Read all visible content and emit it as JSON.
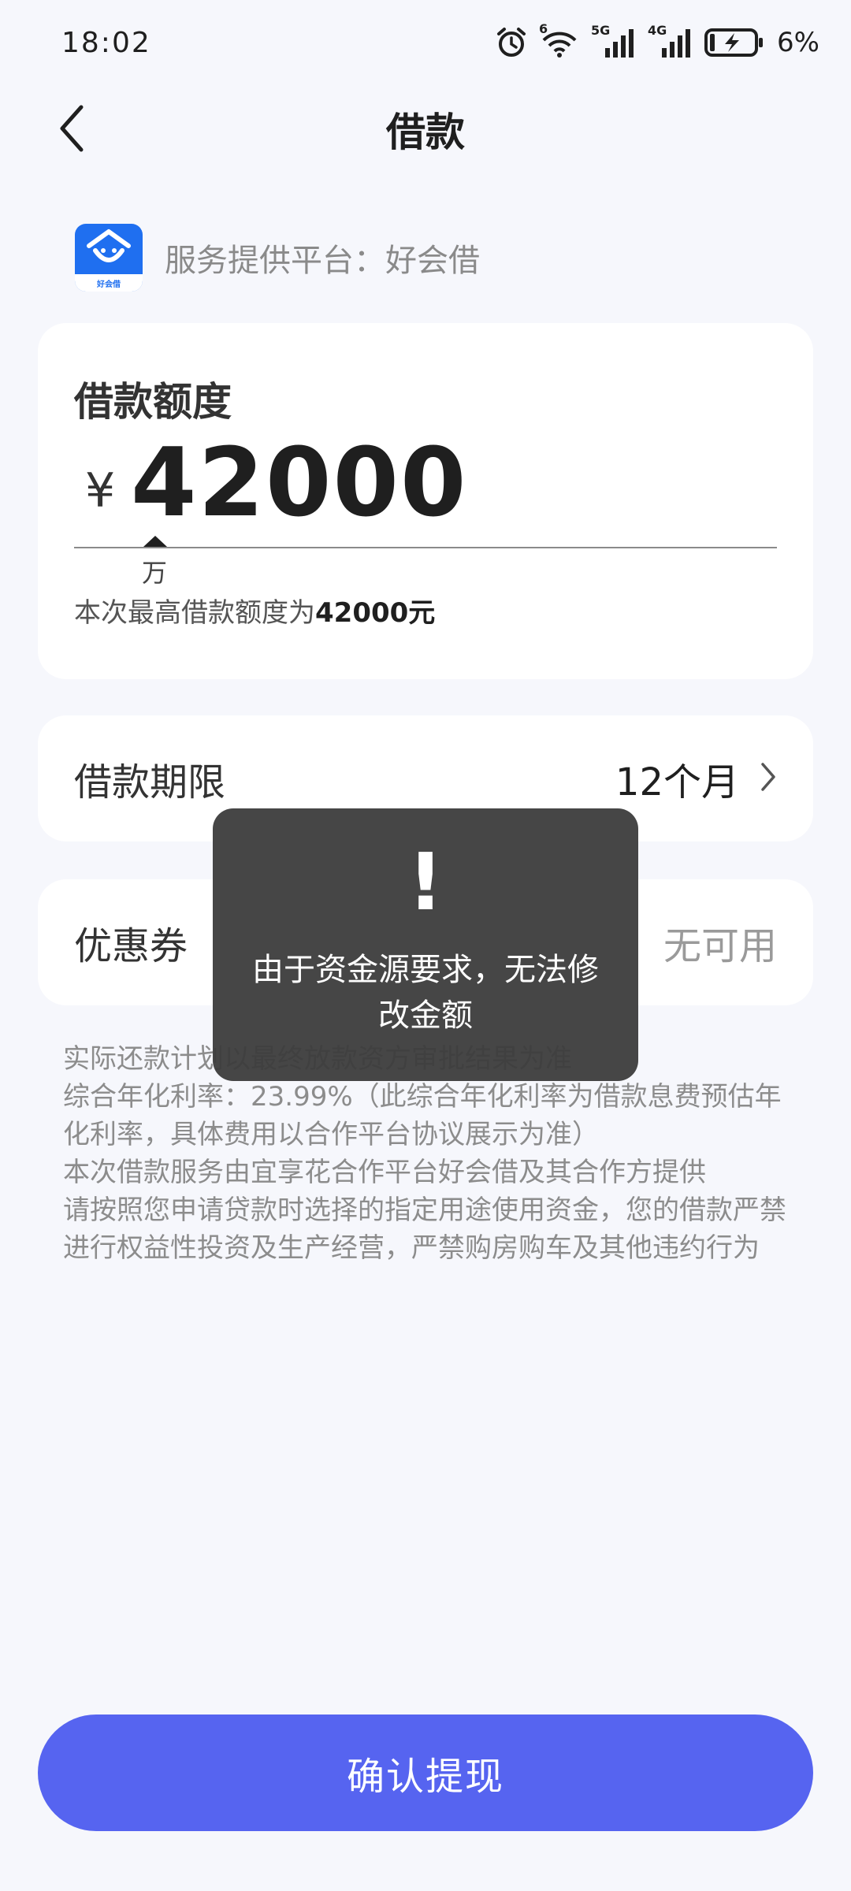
{
  "status_bar": {
    "time": "18:02",
    "battery_percent": "6%",
    "wifi_label": "6",
    "net1": "5G",
    "net2": "4G"
  },
  "header": {
    "title": "借款",
    "back_icon": "chevron-left-icon"
  },
  "provider": {
    "text": "服务提供平台：好会借",
    "logo_text": "好会借"
  },
  "amount_card": {
    "title": "借款额度",
    "currency": "¥",
    "amount": "42000",
    "unit_hint": "万",
    "max_hint_prefix": "本次最高借款额度为",
    "max_hint_amount": "42000元"
  },
  "term": {
    "label": "借款期限",
    "value": "12个月"
  },
  "coupon": {
    "label": "优惠券",
    "value": "无可用"
  },
  "notes": [
    "实际还款计划以最终放款资方审批结果为准",
    "综合年化利率：23.99%（此综合年化利率为借款息费预估年化利率，具体费用以合作平台协议展示为准）",
    "本次借款服务由宜享花合作平台好会借及其合作方提供",
    "请按照您申请贷款时选择的指定用途使用资金，您的借款严禁进行权益性投资及生产经营，严禁购房购车及其他违约行为"
  ],
  "toast": {
    "icon": "!",
    "message": "由于资金源要求，无法修改金额"
  },
  "confirm_button": {
    "label": "确认提现"
  },
  "colors": {
    "primary": "#5664f0",
    "logo_blue": "#1f6ff0",
    "background": "#f6f7fc"
  }
}
